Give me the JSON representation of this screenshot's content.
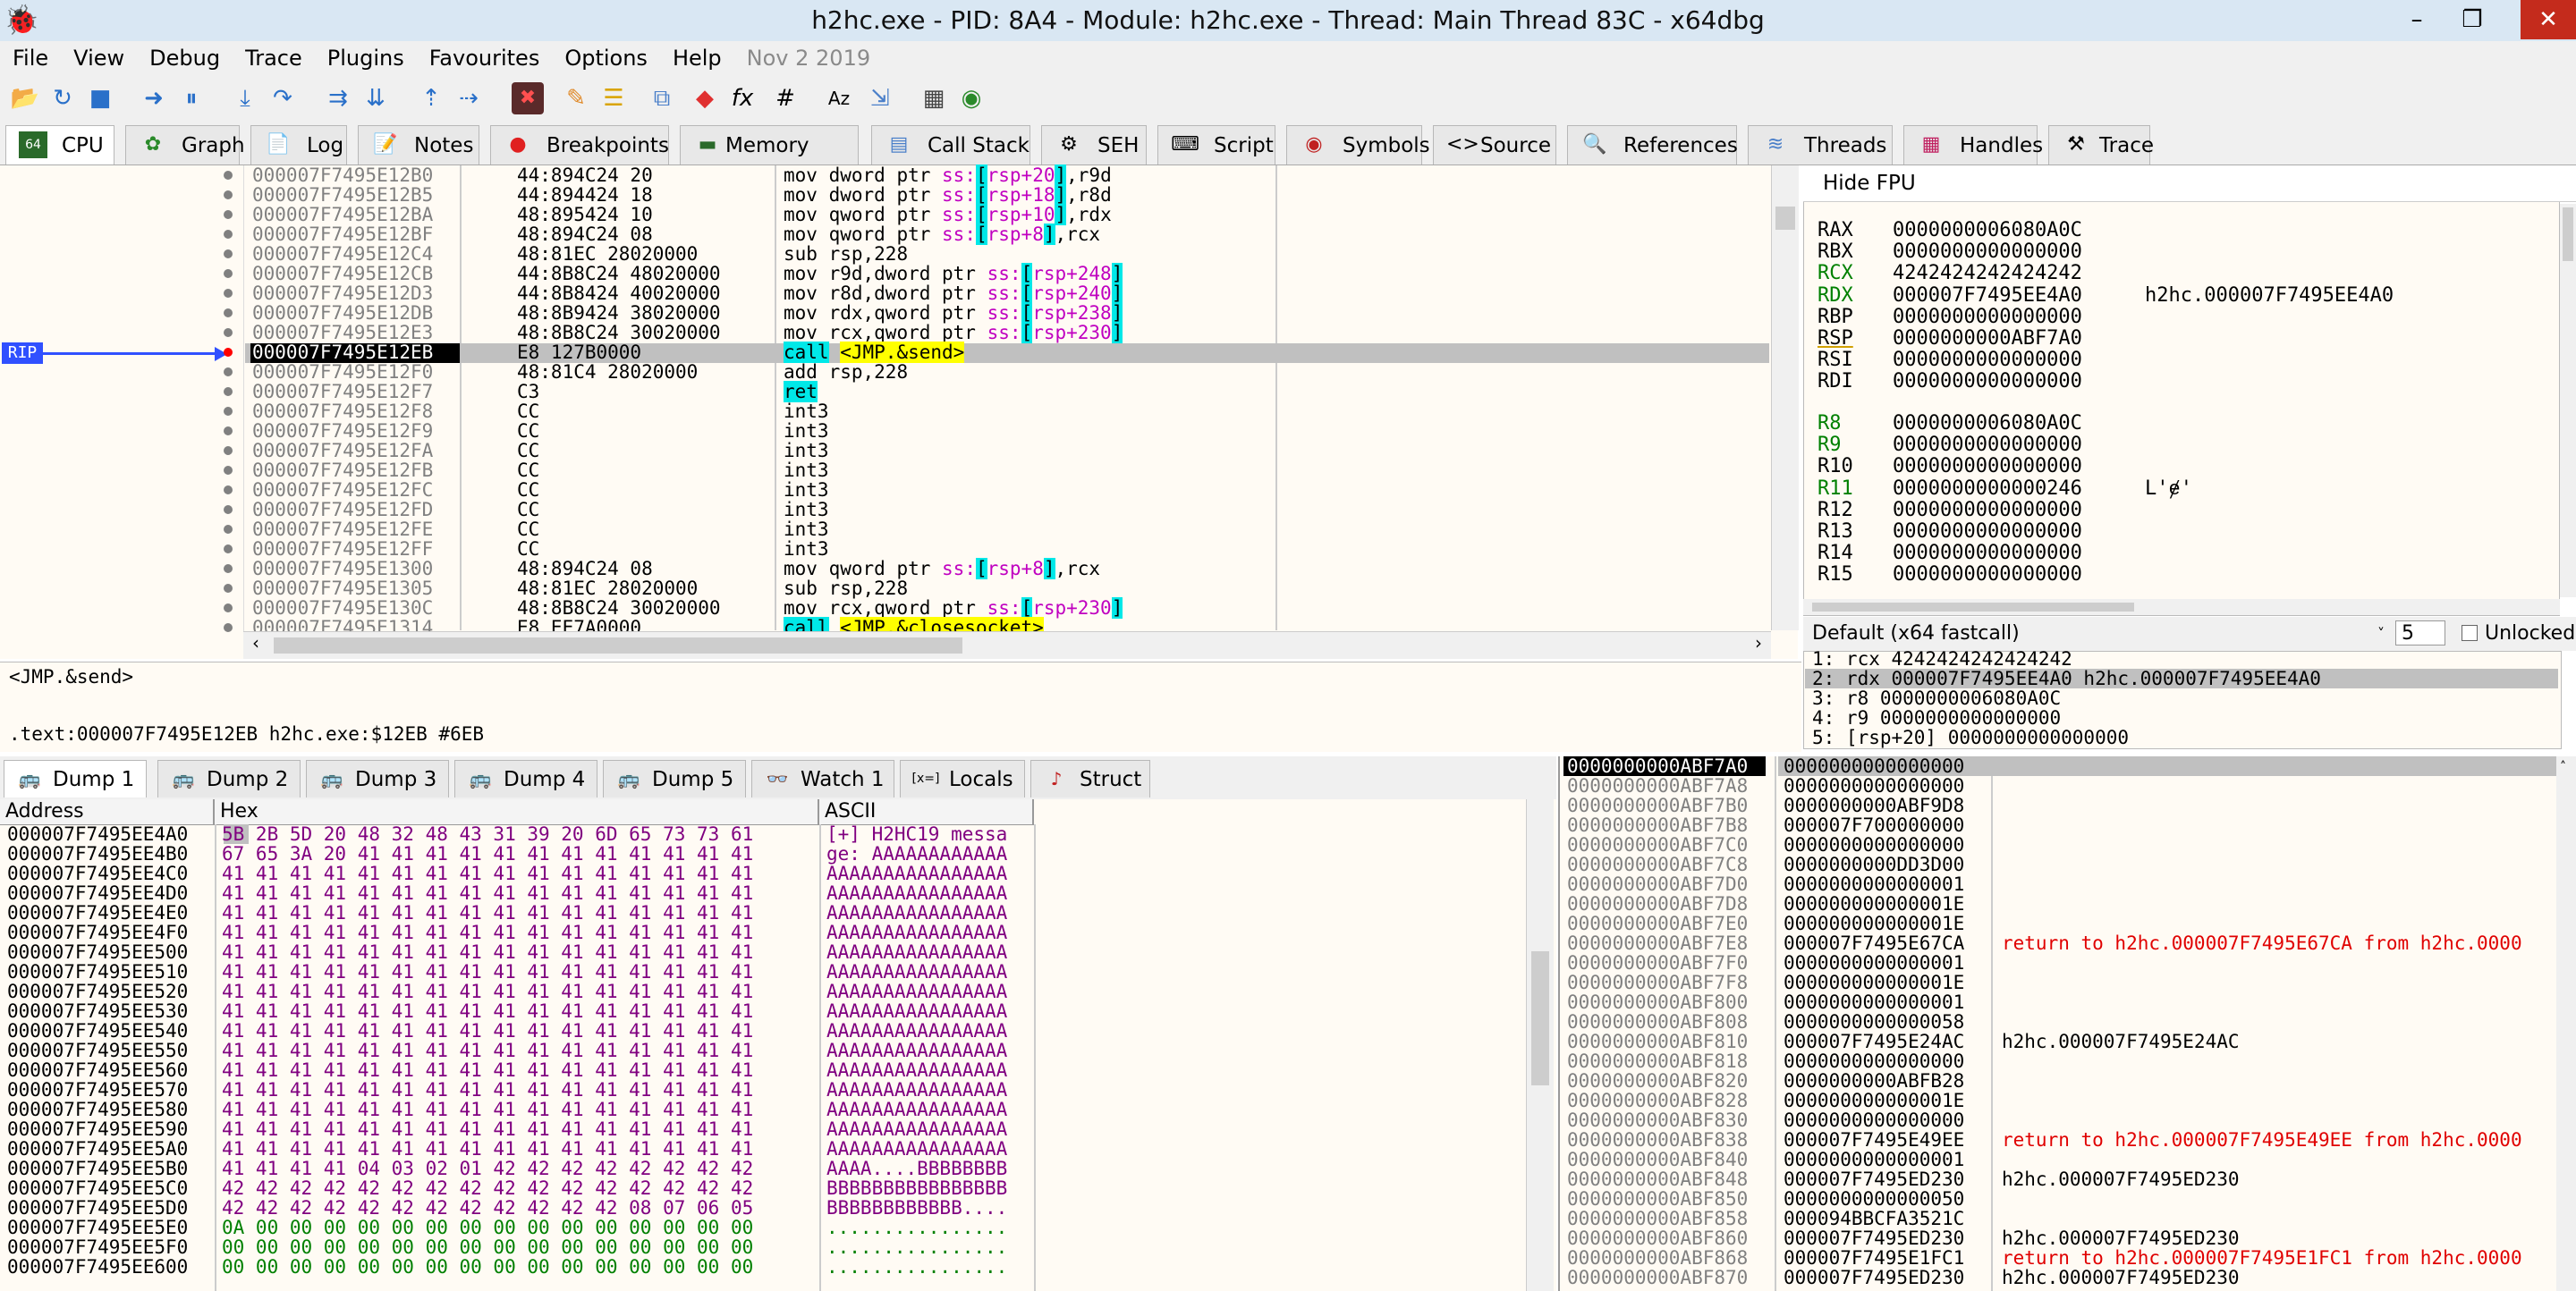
{
  "window": {
    "title": "h2hc.exe - PID: 8A4 - Module: h2hc.exe - Thread: Main Thread 83C - x64dbg"
  },
  "menu": [
    "File",
    "View",
    "Debug",
    "Trace",
    "Plugins",
    "Favourites",
    "Options",
    "Help"
  ],
  "menu_date": "Nov 2 2019",
  "tabs": [
    {
      "label": "CPU",
      "icon": "cpu-icon"
    },
    {
      "label": "Graph",
      "icon": "graph-icon"
    },
    {
      "label": "Log",
      "icon": "log-icon"
    },
    {
      "label": "Notes",
      "icon": "notes-icon"
    },
    {
      "label": "Breakpoints",
      "icon": "breakpoint-icon"
    },
    {
      "label": "Memory Map",
      "icon": "memory-icon"
    },
    {
      "label": "Call Stack",
      "icon": "callstack-icon"
    },
    {
      "label": "SEH",
      "icon": "seh-icon"
    },
    {
      "label": "Script",
      "icon": "script-icon"
    },
    {
      "label": "Symbols",
      "icon": "symbols-icon"
    },
    {
      "label": "Source",
      "icon": "source-icon"
    },
    {
      "label": "References",
      "icon": "references-icon"
    },
    {
      "label": "Threads",
      "icon": "threads-icon"
    },
    {
      "label": "Handles",
      "icon": "handles-icon"
    },
    {
      "label": "Trace",
      "icon": "trace-icon"
    }
  ],
  "rip_label": "RIP",
  "disasm": [
    {
      "addr": "000007F7495E12B0",
      "bytes": "44:894C24 20",
      "op": "mov",
      "args": "dword ptr ss:[rsp+20],r9d"
    },
    {
      "addr": "000007F7495E12B5",
      "bytes": "44:894424 18",
      "op": "mov",
      "args": "dword ptr ss:[rsp+18],r8d"
    },
    {
      "addr": "000007F7495E12BA",
      "bytes": "48:895424 10",
      "op": "mov",
      "args": "qword ptr ss:[rsp+10],rdx"
    },
    {
      "addr": "000007F7495E12BF",
      "bytes": "48:894C24 08",
      "op": "mov",
      "args": "qword ptr ss:[rsp+8],rcx"
    },
    {
      "addr": "000007F7495E12C4",
      "bytes": "48:81EC 28020000",
      "op": "sub",
      "args": "rsp,228"
    },
    {
      "addr": "000007F7495E12CB",
      "bytes": "44:8B8C24 48020000",
      "op": "mov",
      "args": "r9d,dword ptr ss:[rsp+248]"
    },
    {
      "addr": "000007F7495E12D3",
      "bytes": "44:8B8424 40020000",
      "op": "mov",
      "args": "r8d,dword ptr ss:[rsp+240]"
    },
    {
      "addr": "000007F7495E12DB",
      "bytes": "48:8B9424 38020000",
      "op": "mov",
      "args": "rdx,qword ptr ss:[rsp+238]"
    },
    {
      "addr": "000007F7495E12E3",
      "bytes": "48:8B8C24 30020000",
      "op": "mov",
      "args": "rcx,qword ptr ss:[rsp+230]"
    },
    {
      "addr": "000007F7495E12EB",
      "bytes": "E8 127B0000",
      "op": "call",
      "args": "<JMP.&send>"
    },
    {
      "addr": "000007F7495E12F0",
      "bytes": "48:81C4 28020000",
      "op": "add",
      "args": "rsp,228"
    },
    {
      "addr": "000007F7495E12F7",
      "bytes": "C3",
      "op": "ret",
      "args": ""
    },
    {
      "addr": "000007F7495E12F8",
      "bytes": "CC",
      "op": "int3",
      "args": ""
    },
    {
      "addr": "000007F7495E12F9",
      "bytes": "CC",
      "op": "int3",
      "args": ""
    },
    {
      "addr": "000007F7495E12FA",
      "bytes": "CC",
      "op": "int3",
      "args": ""
    },
    {
      "addr": "000007F7495E12FB",
      "bytes": "CC",
      "op": "int3",
      "args": ""
    },
    {
      "addr": "000007F7495E12FC",
      "bytes": "CC",
      "op": "int3",
      "args": ""
    },
    {
      "addr": "000007F7495E12FD",
      "bytes": "CC",
      "op": "int3",
      "args": ""
    },
    {
      "addr": "000007F7495E12FE",
      "bytes": "CC",
      "op": "int3",
      "args": ""
    },
    {
      "addr": "000007F7495E12FF",
      "bytes": "CC",
      "op": "int3",
      "args": ""
    },
    {
      "addr": "000007F7495E1300",
      "bytes": "48:894C24 08",
      "op": "mov",
      "args": "qword ptr ss:[rsp+8],rcx"
    },
    {
      "addr": "000007F7495E1305",
      "bytes": "48:81EC 28020000",
      "op": "sub",
      "args": "rsp,228"
    },
    {
      "addr": "000007F7495E130C",
      "bytes": "48:8B8C24 30020000",
      "op": "mov",
      "args": "rcx,qword ptr ss:[rsp+230]"
    },
    {
      "addr": "000007F7495E1314",
      "bytes": "E8 EE7A0000",
      "op": "call",
      "args": "<JMP.&closesocket>"
    }
  ],
  "registers": {
    "header": "Hide FPU",
    "list": [
      {
        "name": "RAX",
        "value": "0000000006080A0C",
        "info": ""
      },
      {
        "name": "RBX",
        "value": "0000000000000000",
        "info": ""
      },
      {
        "name": "RCX",
        "value": "4242424242424242",
        "info": ""
      },
      {
        "name": "RDX",
        "value": "000007F7495EE4A0",
        "info": "h2hc.000007F7495EE4A0"
      },
      {
        "name": "RBP",
        "value": "0000000000000000",
        "info": ""
      },
      {
        "name": "RSP",
        "value": "0000000000ABF7A0",
        "info": ""
      },
      {
        "name": "RSI",
        "value": "0000000000000000",
        "info": ""
      },
      {
        "name": "RDI",
        "value": "0000000000000000",
        "info": ""
      },
      {
        "name": "R8",
        "value": "0000000006080A0C",
        "info": ""
      },
      {
        "name": "R9",
        "value": "0000000000000000",
        "info": ""
      },
      {
        "name": "R10",
        "value": "0000000000000000",
        "info": ""
      },
      {
        "name": "R11",
        "value": "0000000000000246",
        "info": "L'ɇ'"
      },
      {
        "name": "R12",
        "value": "0000000000000000",
        "info": ""
      },
      {
        "name": "R13",
        "value": "0000000000000000",
        "info": ""
      },
      {
        "name": "R14",
        "value": "0000000000000000",
        "info": ""
      },
      {
        "name": "R15",
        "value": "0000000000000000",
        "info": ""
      }
    ]
  },
  "callconv": {
    "label": "Default (x64 fastcall)",
    "count": "5",
    "unlocked": "Unlocked"
  },
  "args": [
    "1: rcx 4242424242424242",
    "2: rdx 000007F7495EE4A0 h2hc.000007F7495EE4A0",
    "3: r8 0000000006080A0C",
    "4: r9 0000000000000000",
    "5: [rsp+20] 0000000000000000"
  ],
  "info": {
    "line1": "<JMP.&send>",
    "line2": ".text:000007F7495E12EB h2hc.exe:$12EB #6EB"
  },
  "dump_tabs": [
    "Dump 1",
    "Dump 2",
    "Dump 3",
    "Dump 4",
    "Dump 5",
    "Watch 1",
    "Locals",
    "Struct"
  ],
  "dump_headers": {
    "address": "Address",
    "hex": "Hex",
    "ascii": "ASCII"
  },
  "dump": [
    {
      "addr": "000007F7495EE4A0",
      "hex": "5B 2B 5D 20 48 32 48 43 31 39 20 6D 65 73 73 61",
      "ascii": "[+] H2HC19 messa"
    },
    {
      "addr": "000007F7495EE4B0",
      "hex": "67 65 3A 20 41 41 41 41 41 41 41 41 41 41 41 41",
      "ascii": "ge: AAAAAAAAAAAA"
    },
    {
      "addr": "000007F7495EE4C0",
      "hex": "41 41 41 41 41 41 41 41 41 41 41 41 41 41 41 41",
      "ascii": "AAAAAAAAAAAAAAAA"
    },
    {
      "addr": "000007F7495EE4D0",
      "hex": "41 41 41 41 41 41 41 41 41 41 41 41 41 41 41 41",
      "ascii": "AAAAAAAAAAAAAAAA"
    },
    {
      "addr": "000007F7495EE4E0",
      "hex": "41 41 41 41 41 41 41 41 41 41 41 41 41 41 41 41",
      "ascii": "AAAAAAAAAAAAAAAA"
    },
    {
      "addr": "000007F7495EE4F0",
      "hex": "41 41 41 41 41 41 41 41 41 41 41 41 41 41 41 41",
      "ascii": "AAAAAAAAAAAAAAAA"
    },
    {
      "addr": "000007F7495EE500",
      "hex": "41 41 41 41 41 41 41 41 41 41 41 41 41 41 41 41",
      "ascii": "AAAAAAAAAAAAAAAA"
    },
    {
      "addr": "000007F7495EE510",
      "hex": "41 41 41 41 41 41 41 41 41 41 41 41 41 41 41 41",
      "ascii": "AAAAAAAAAAAAAAAA"
    },
    {
      "addr": "000007F7495EE520",
      "hex": "41 41 41 41 41 41 41 41 41 41 41 41 41 41 41 41",
      "ascii": "AAAAAAAAAAAAAAAA"
    },
    {
      "addr": "000007F7495EE530",
      "hex": "41 41 41 41 41 41 41 41 41 41 41 41 41 41 41 41",
      "ascii": "AAAAAAAAAAAAAAAA"
    },
    {
      "addr": "000007F7495EE540",
      "hex": "41 41 41 41 41 41 41 41 41 41 41 41 41 41 41 41",
      "ascii": "AAAAAAAAAAAAAAAA"
    },
    {
      "addr": "000007F7495EE550",
      "hex": "41 41 41 41 41 41 41 41 41 41 41 41 41 41 41 41",
      "ascii": "AAAAAAAAAAAAAAAA"
    },
    {
      "addr": "000007F7495EE560",
      "hex": "41 41 41 41 41 41 41 41 41 41 41 41 41 41 41 41",
      "ascii": "AAAAAAAAAAAAAAAA"
    },
    {
      "addr": "000007F7495EE570",
      "hex": "41 41 41 41 41 41 41 41 41 41 41 41 41 41 41 41",
      "ascii": "AAAAAAAAAAAAAAAA"
    },
    {
      "addr": "000007F7495EE580",
      "hex": "41 41 41 41 41 41 41 41 41 41 41 41 41 41 41 41",
      "ascii": "AAAAAAAAAAAAAAAA"
    },
    {
      "addr": "000007F7495EE590",
      "hex": "41 41 41 41 41 41 41 41 41 41 41 41 41 41 41 41",
      "ascii": "AAAAAAAAAAAAAAAA"
    },
    {
      "addr": "000007F7495EE5A0",
      "hex": "41 41 41 41 41 41 41 41 41 41 41 41 41 41 41 41",
      "ascii": "AAAAAAAAAAAAAAAA"
    },
    {
      "addr": "000007F7495EE5B0",
      "hex": "41 41 41 41 04 03 02 01 42 42 42 42 42 42 42 42",
      "ascii": "AAAA....BBBBBBBB"
    },
    {
      "addr": "000007F7495EE5C0",
      "hex": "42 42 42 42 42 42 42 42 42 42 42 42 42 42 42 42",
      "ascii": "BBBBBBBBBBBBBBBB"
    },
    {
      "addr": "000007F7495EE5D0",
      "hex": "42 42 42 42 42 42 42 42 42 42 42 42 08 07 06 05",
      "ascii": "BBBBBBBBBBBB...."
    },
    {
      "addr": "000007F7495EE5E0",
      "hex": "0A 00 00 00 00 00 00 00 00 00 00 00 00 00 00 00",
      "ascii": "................"
    },
    {
      "addr": "000007F7495EE5F0",
      "hex": "00 00 00 00 00 00 00 00 00 00 00 00 00 00 00 00",
      "ascii": "................"
    },
    {
      "addr": "000007F7495EE600",
      "hex": "00 00 00 00 00 00 00 00 00 00 00 00 00 00 00 00",
      "ascii": "................"
    }
  ],
  "stack": [
    {
      "addr": "0000000000ABF7A0",
      "val": "0000000000000000",
      "com": "",
      "red": false
    },
    {
      "addr": "0000000000ABF7A8",
      "val": "0000000000000000",
      "com": "",
      "red": false
    },
    {
      "addr": "0000000000ABF7B0",
      "val": "0000000000ABF9D8",
      "com": "",
      "red": false
    },
    {
      "addr": "0000000000ABF7B8",
      "val": "000007F700000000",
      "com": "",
      "red": false
    },
    {
      "addr": "0000000000ABF7C0",
      "val": "0000000000000000",
      "com": "",
      "red": false
    },
    {
      "addr": "0000000000ABF7C8",
      "val": "0000000000DD3D00",
      "com": "",
      "red": false
    },
    {
      "addr": "0000000000ABF7D0",
      "val": "0000000000000001",
      "com": "",
      "red": false
    },
    {
      "addr": "0000000000ABF7D8",
      "val": "000000000000001E",
      "com": "",
      "red": false
    },
    {
      "addr": "0000000000ABF7E0",
      "val": "000000000000001E",
      "com": "",
      "red": false
    },
    {
      "addr": "0000000000ABF7E8",
      "val": "000007F7495E67CA",
      "com": "return to h2hc.000007F7495E67CA from h2hc.0000",
      "red": true
    },
    {
      "addr": "0000000000ABF7F0",
      "val": "0000000000000001",
      "com": "",
      "red": false
    },
    {
      "addr": "0000000000ABF7F8",
      "val": "000000000000001E",
      "com": "",
      "red": false
    },
    {
      "addr": "0000000000ABF800",
      "val": "0000000000000001",
      "com": "",
      "red": false
    },
    {
      "addr": "0000000000ABF808",
      "val": "0000000000000058",
      "com": "",
      "red": false
    },
    {
      "addr": "0000000000ABF810",
      "val": "000007F7495E24AC",
      "com": "h2hc.000007F7495E24AC",
      "red": false
    },
    {
      "addr": "0000000000ABF818",
      "val": "0000000000000000",
      "com": "",
      "red": false
    },
    {
      "addr": "0000000000ABF820",
      "val": "0000000000ABFB28",
      "com": "",
      "red": false
    },
    {
      "addr": "0000000000ABF828",
      "val": "000000000000001E",
      "com": "",
      "red": false
    },
    {
      "addr": "0000000000ABF830",
      "val": "0000000000000000",
      "com": "",
      "red": false
    },
    {
      "addr": "0000000000ABF838",
      "val": "000007F7495E49EE",
      "com": "return to h2hc.000007F7495E49EE from h2hc.0000",
      "red": true
    },
    {
      "addr": "0000000000ABF840",
      "val": "0000000000000001",
      "com": "",
      "red": false
    },
    {
      "addr": "0000000000ABF848",
      "val": "000007F7495ED230",
      "com": "h2hc.000007F7495ED230",
      "red": false
    },
    {
      "addr": "0000000000ABF850",
      "val": "0000000000000050",
      "com": "",
      "red": false
    },
    {
      "addr": "0000000000ABF858",
      "val": "000094BBCFA3521C",
      "com": "",
      "red": false
    },
    {
      "addr": "0000000000ABF860",
      "val": "000007F7495ED230",
      "com": "h2hc.000007F7495ED230",
      "red": false
    },
    {
      "addr": "0000000000ABF868",
      "val": "000007F7495E1FC1",
      "com": "return to h2hc.000007F7495E1FC1 from h2hc.0000",
      "red": true
    },
    {
      "addr": "0000000000ABF870",
      "val": "000007F7495ED230",
      "com": "h2hc.000007F7495ED230",
      "red": false
    }
  ]
}
